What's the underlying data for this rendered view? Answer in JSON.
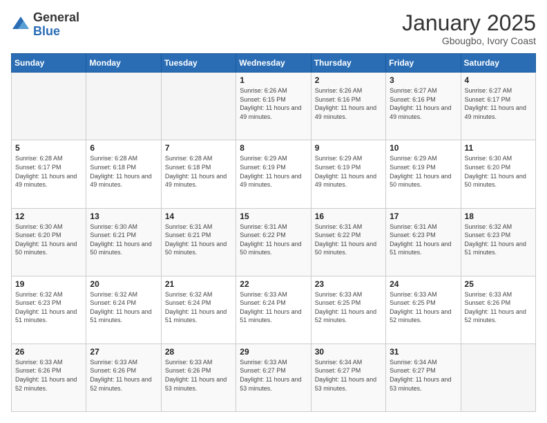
{
  "header": {
    "logo": {
      "general": "General",
      "blue": "Blue"
    },
    "title": "January 2025",
    "subtitle": "Gbougbo, Ivory Coast"
  },
  "weekdays": [
    "Sunday",
    "Monday",
    "Tuesday",
    "Wednesday",
    "Thursday",
    "Friday",
    "Saturday"
  ],
  "weeks": [
    [
      {
        "day": "",
        "sunrise": "",
        "sunset": "",
        "daylight": ""
      },
      {
        "day": "",
        "sunrise": "",
        "sunset": "",
        "daylight": ""
      },
      {
        "day": "",
        "sunrise": "",
        "sunset": "",
        "daylight": ""
      },
      {
        "day": "1",
        "sunrise": "Sunrise: 6:26 AM",
        "sunset": "Sunset: 6:15 PM",
        "daylight": "Daylight: 11 hours and 49 minutes."
      },
      {
        "day": "2",
        "sunrise": "Sunrise: 6:26 AM",
        "sunset": "Sunset: 6:16 PM",
        "daylight": "Daylight: 11 hours and 49 minutes."
      },
      {
        "day": "3",
        "sunrise": "Sunrise: 6:27 AM",
        "sunset": "Sunset: 6:16 PM",
        "daylight": "Daylight: 11 hours and 49 minutes."
      },
      {
        "day": "4",
        "sunrise": "Sunrise: 6:27 AM",
        "sunset": "Sunset: 6:17 PM",
        "daylight": "Daylight: 11 hours and 49 minutes."
      }
    ],
    [
      {
        "day": "5",
        "sunrise": "Sunrise: 6:28 AM",
        "sunset": "Sunset: 6:17 PM",
        "daylight": "Daylight: 11 hours and 49 minutes."
      },
      {
        "day": "6",
        "sunrise": "Sunrise: 6:28 AM",
        "sunset": "Sunset: 6:18 PM",
        "daylight": "Daylight: 11 hours and 49 minutes."
      },
      {
        "day": "7",
        "sunrise": "Sunrise: 6:28 AM",
        "sunset": "Sunset: 6:18 PM",
        "daylight": "Daylight: 11 hours and 49 minutes."
      },
      {
        "day": "8",
        "sunrise": "Sunrise: 6:29 AM",
        "sunset": "Sunset: 6:19 PM",
        "daylight": "Daylight: 11 hours and 49 minutes."
      },
      {
        "day": "9",
        "sunrise": "Sunrise: 6:29 AM",
        "sunset": "Sunset: 6:19 PM",
        "daylight": "Daylight: 11 hours and 49 minutes."
      },
      {
        "day": "10",
        "sunrise": "Sunrise: 6:29 AM",
        "sunset": "Sunset: 6:19 PM",
        "daylight": "Daylight: 11 hours and 50 minutes."
      },
      {
        "day": "11",
        "sunrise": "Sunrise: 6:30 AM",
        "sunset": "Sunset: 6:20 PM",
        "daylight": "Daylight: 11 hours and 50 minutes."
      }
    ],
    [
      {
        "day": "12",
        "sunrise": "Sunrise: 6:30 AM",
        "sunset": "Sunset: 6:20 PM",
        "daylight": "Daylight: 11 hours and 50 minutes."
      },
      {
        "day": "13",
        "sunrise": "Sunrise: 6:30 AM",
        "sunset": "Sunset: 6:21 PM",
        "daylight": "Daylight: 11 hours and 50 minutes."
      },
      {
        "day": "14",
        "sunrise": "Sunrise: 6:31 AM",
        "sunset": "Sunset: 6:21 PM",
        "daylight": "Daylight: 11 hours and 50 minutes."
      },
      {
        "day": "15",
        "sunrise": "Sunrise: 6:31 AM",
        "sunset": "Sunset: 6:22 PM",
        "daylight": "Daylight: 11 hours and 50 minutes."
      },
      {
        "day": "16",
        "sunrise": "Sunrise: 6:31 AM",
        "sunset": "Sunset: 6:22 PM",
        "daylight": "Daylight: 11 hours and 50 minutes."
      },
      {
        "day": "17",
        "sunrise": "Sunrise: 6:31 AM",
        "sunset": "Sunset: 6:23 PM",
        "daylight": "Daylight: 11 hours and 51 minutes."
      },
      {
        "day": "18",
        "sunrise": "Sunrise: 6:32 AM",
        "sunset": "Sunset: 6:23 PM",
        "daylight": "Daylight: 11 hours and 51 minutes."
      }
    ],
    [
      {
        "day": "19",
        "sunrise": "Sunrise: 6:32 AM",
        "sunset": "Sunset: 6:23 PM",
        "daylight": "Daylight: 11 hours and 51 minutes."
      },
      {
        "day": "20",
        "sunrise": "Sunrise: 6:32 AM",
        "sunset": "Sunset: 6:24 PM",
        "daylight": "Daylight: 11 hours and 51 minutes."
      },
      {
        "day": "21",
        "sunrise": "Sunrise: 6:32 AM",
        "sunset": "Sunset: 6:24 PM",
        "daylight": "Daylight: 11 hours and 51 minutes."
      },
      {
        "day": "22",
        "sunrise": "Sunrise: 6:33 AM",
        "sunset": "Sunset: 6:24 PM",
        "daylight": "Daylight: 11 hours and 51 minutes."
      },
      {
        "day": "23",
        "sunrise": "Sunrise: 6:33 AM",
        "sunset": "Sunset: 6:25 PM",
        "daylight": "Daylight: 11 hours and 52 minutes."
      },
      {
        "day": "24",
        "sunrise": "Sunrise: 6:33 AM",
        "sunset": "Sunset: 6:25 PM",
        "daylight": "Daylight: 11 hours and 52 minutes."
      },
      {
        "day": "25",
        "sunrise": "Sunrise: 6:33 AM",
        "sunset": "Sunset: 6:26 PM",
        "daylight": "Daylight: 11 hours and 52 minutes."
      }
    ],
    [
      {
        "day": "26",
        "sunrise": "Sunrise: 6:33 AM",
        "sunset": "Sunset: 6:26 PM",
        "daylight": "Daylight: 11 hours and 52 minutes."
      },
      {
        "day": "27",
        "sunrise": "Sunrise: 6:33 AM",
        "sunset": "Sunset: 6:26 PM",
        "daylight": "Daylight: 11 hours and 52 minutes."
      },
      {
        "day": "28",
        "sunrise": "Sunrise: 6:33 AM",
        "sunset": "Sunset: 6:26 PM",
        "daylight": "Daylight: 11 hours and 53 minutes."
      },
      {
        "day": "29",
        "sunrise": "Sunrise: 6:33 AM",
        "sunset": "Sunset: 6:27 PM",
        "daylight": "Daylight: 11 hours and 53 minutes."
      },
      {
        "day": "30",
        "sunrise": "Sunrise: 6:34 AM",
        "sunset": "Sunset: 6:27 PM",
        "daylight": "Daylight: 11 hours and 53 minutes."
      },
      {
        "day": "31",
        "sunrise": "Sunrise: 6:34 AM",
        "sunset": "Sunset: 6:27 PM",
        "daylight": "Daylight: 11 hours and 53 minutes."
      },
      {
        "day": "",
        "sunrise": "",
        "sunset": "",
        "daylight": ""
      }
    ]
  ]
}
